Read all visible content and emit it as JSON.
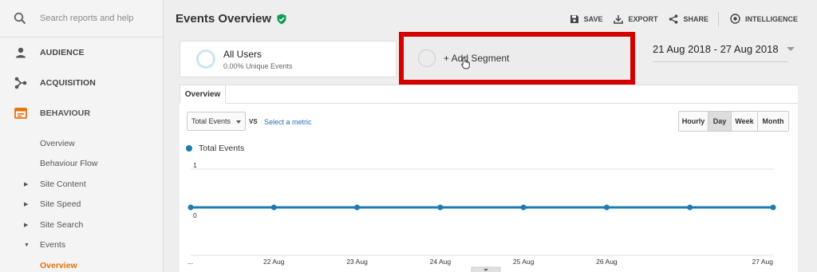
{
  "search": {
    "placeholder": "Search reports and help"
  },
  "sidebar": {
    "sections": [
      {
        "label": "AUDIENCE",
        "icon": "person-icon"
      },
      {
        "label": "ACQUISITION",
        "icon": "acquisition-icon"
      },
      {
        "label": "BEHAVIOUR",
        "icon": "behaviour-icon"
      }
    ],
    "behaviour_items": [
      {
        "label": "Overview",
        "expandable": false
      },
      {
        "label": "Behaviour Flow",
        "expandable": false
      },
      {
        "label": "Site Content",
        "expandable": true
      },
      {
        "label": "Site Speed",
        "expandable": true
      },
      {
        "label": "Site Search",
        "expandable": true
      },
      {
        "label": "Events",
        "expandable": true,
        "expanded": true
      }
    ],
    "events_items": [
      {
        "label": "Overview"
      }
    ]
  },
  "header": {
    "title": "Events Overview",
    "actions": {
      "save": "SAVE",
      "export": "EXPORT",
      "share": "SHARE",
      "intelligence": "INTELLIGENCE"
    }
  },
  "segment": {
    "title": "All Users",
    "subtitle": "0.00% Unique Events",
    "add_label": "+ Add Segment"
  },
  "date_range": "21 Aug 2018 - 27 Aug 2018",
  "tabs": [
    "Overview"
  ],
  "controls": {
    "metric": "Total Events",
    "vs": "VS",
    "select_metric": "Select a metric",
    "granularity": [
      "Hourly",
      "Day",
      "Week",
      "Month"
    ],
    "selected_granularity": "Day"
  },
  "colors": {
    "accent": "#e8710a",
    "line": "#1c7cae",
    "highlight": "#d40000",
    "link": "#2a6ebb"
  },
  "chart_data": {
    "type": "line",
    "series": [
      {
        "name": "Total Events",
        "values": [
          0,
          0,
          0,
          0,
          0,
          0,
          0,
          0
        ]
      }
    ],
    "x": [
      "...",
      "22 Aug",
      "23 Aug",
      "24 Aug",
      "25 Aug",
      "26 Aug",
      "27 Aug"
    ],
    "y_ticks": [
      "1",
      "0"
    ],
    "ylim": [
      0,
      1
    ],
    "grid": true
  }
}
